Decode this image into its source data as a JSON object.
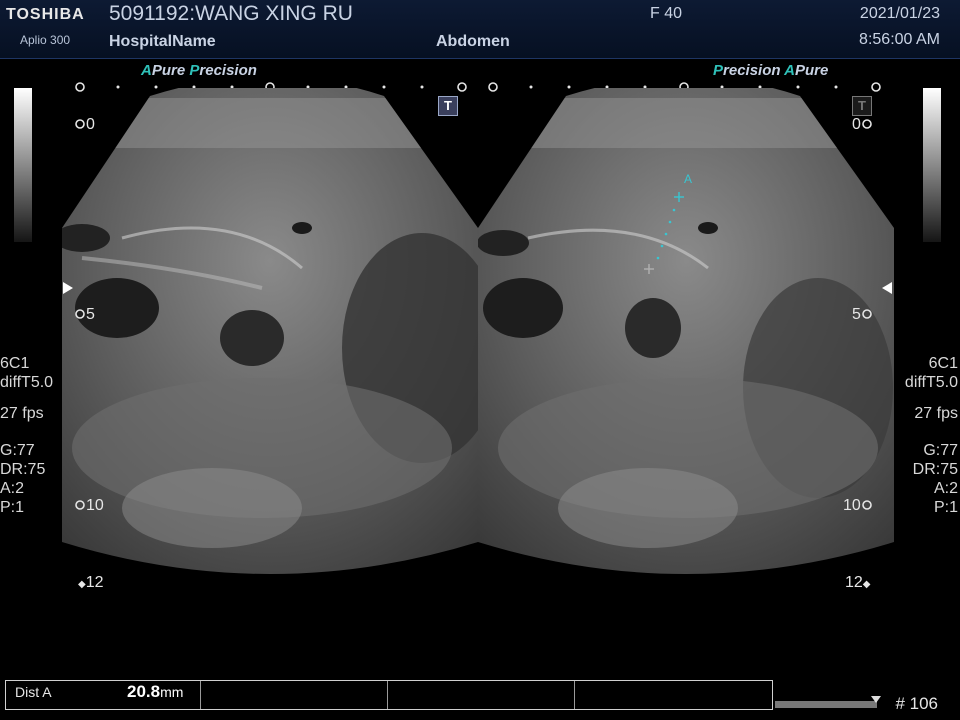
{
  "header": {
    "brand": "TOSHIBA",
    "model": "Aplio 300",
    "patient": "5091192:WANG XING RU",
    "hospital": "HospitalName",
    "frequency": "F  40",
    "preset": "Abdomen",
    "date": "2021/01/23",
    "time": "8:56:00 AM"
  },
  "left_pane": {
    "mode_a": "A",
    "mode_pure": "Pure",
    "mode_precision_p": "P",
    "mode_precision_rest": "recision",
    "badge": "T"
  },
  "right_pane": {
    "mode_precision_p": "P",
    "mode_precision_rest": "recision",
    "mode_a": "A",
    "mode_pure": "Pure",
    "badge": "T",
    "caliper_label": "A"
  },
  "depth_scale": {
    "d0": "0",
    "d5": "5",
    "d10": "10",
    "d12": "12"
  },
  "left_info": {
    "probe": "6C1",
    "filter": "diffT5.0",
    "fps": "27 fps",
    "gain": "G:77",
    "dr": "DR:75",
    "a": "A:2",
    "p": "P:1"
  },
  "right_info": {
    "probe": "6C1",
    "filter": "diffT5.0",
    "fps": "27 fps",
    "gain": "G:77",
    "dr": "DR:75",
    "a": "A:2",
    "p": "P:1"
  },
  "measurement": {
    "label": "Dist A",
    "value": "20.8",
    "unit": "mm"
  },
  "frame_counter": "# 106",
  "colors": {
    "header_bg": "#0d1a33",
    "accent_teal": "#2fc1b9",
    "caliper_color": "#39c6d2"
  }
}
